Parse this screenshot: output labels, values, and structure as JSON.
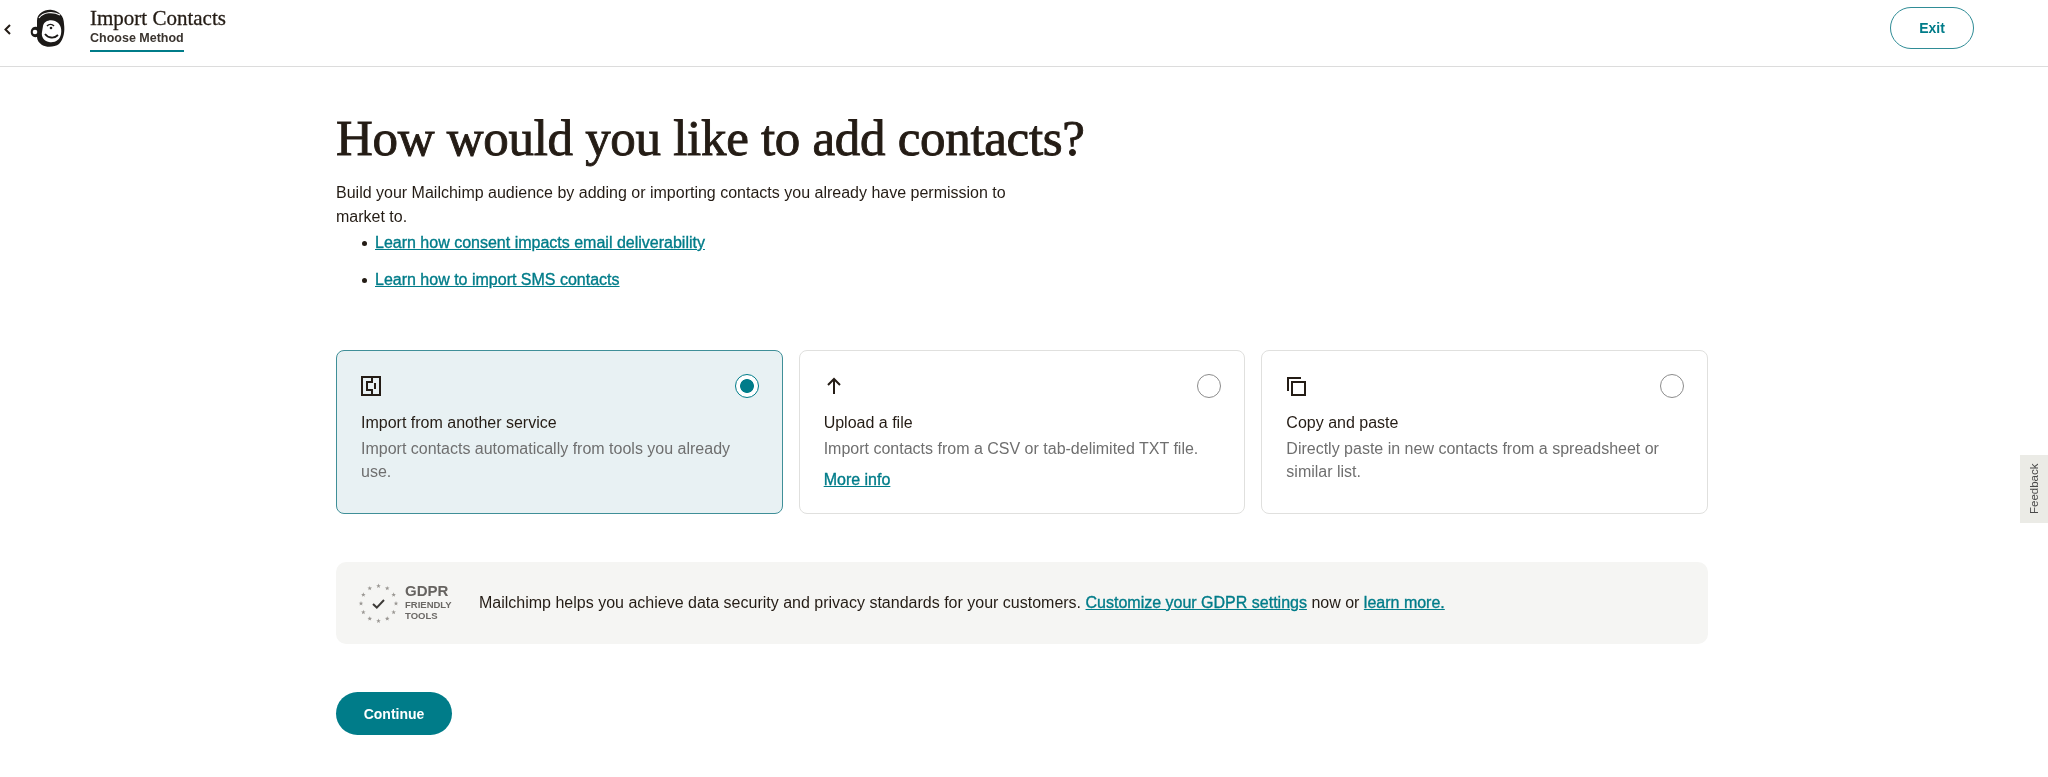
{
  "header": {
    "title": "Import Contacts",
    "step": "Choose Method",
    "exit_button": "Exit"
  },
  "heading": "How would you like to add contacts?",
  "intro": "Build your Mailchimp audience by adding or importing contacts you already have permission to market to.",
  "links": [
    "Learn how consent impacts email deliverability",
    "Learn how to import SMS contacts"
  ],
  "cards": [
    {
      "kind": "service",
      "title": "Import from another service",
      "description": "Import contacts automatically from tools you already use.",
      "selected": true
    },
    {
      "kind": "file",
      "title": "Upload a file",
      "description": "Import contacts from a CSV or tab-delimited TXT file.",
      "link": "More info",
      "selected": false
    },
    {
      "kind": "paste",
      "title": "Copy and paste",
      "description": "Directly paste in new contacts from a spreadsheet or similar list.",
      "selected": false
    }
  ],
  "gdpr": {
    "badge_title": "GDPR",
    "badge_lines": [
      "FRIENDLY",
      "TOOLS"
    ],
    "message": {
      "before": "Mailchimp helps you achieve data security and privacy standards for your customers.",
      "settings_link": "Customize your GDPR settings",
      "between": "now or",
      "learn_link": "learn more."
    }
  },
  "continue_button": "Continue",
  "feedback_tab": "Feedback"
}
